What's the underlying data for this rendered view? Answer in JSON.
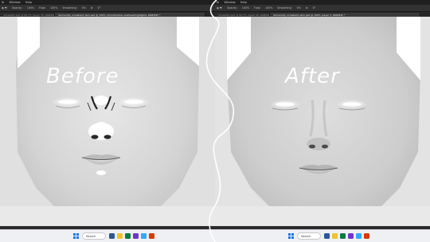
{
  "menubar": {
    "items": [
      "Ie",
      "Window",
      "Help"
    ]
  },
  "options": {
    "opacity_label": "Opacity:",
    "opacity_value": "100%",
    "flow_label": "Flow:",
    "flow_value": "100%",
    "smoothing_label": "Smoothing:",
    "smoothing_value": "0%",
    "angle_value": "0°"
  },
  "left": {
    "tabs": [
      "ralnes001.psd @ 66.7% (Layer 15, RGB/8#) *",
      "dermemily unresheim skin.psd @ 100% (Smoothskine shadows/highlights, RGB/8#) *"
    ],
    "overlay_label": "Before"
  },
  "right": {
    "tabs": [
      "ralnes001.psd @ 66.7% (Layer 15, RGB/8#) *",
      "dermemily unresheim skin.psd @ 100% (Layer 3, RGB/8#) *"
    ],
    "overlay_label": "After"
  },
  "taskbar": {
    "search_label": "Search"
  },
  "colors": {
    "accent": "#1a73e8",
    "skin": "#d9d9d9",
    "canvas": "#e9e9e9",
    "ui_dark": "#323232"
  }
}
